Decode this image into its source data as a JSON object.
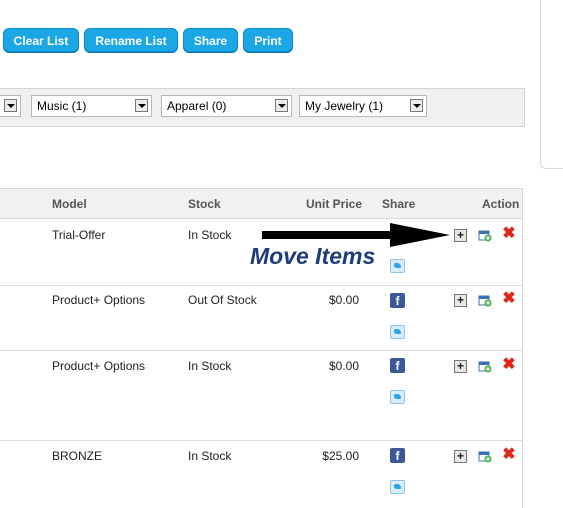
{
  "toolbar": {
    "clear_label": "Clear List",
    "rename_label": "Rename List",
    "share_label": "Share",
    "print_label": "Print"
  },
  "filters": {
    "items": [
      {
        "label": ""
      },
      {
        "label": "Music (1)"
      },
      {
        "label": "Apparel (0)"
      },
      {
        "label": "My Jewelry (1)"
      }
    ]
  },
  "table": {
    "headers": {
      "model": "Model",
      "stock": "Stock",
      "unit_price": "Unit Price",
      "share": "Share",
      "action": "Action"
    },
    "rows": [
      {
        "model": "Trial-Offer",
        "stock": "In Stock",
        "price": ""
      },
      {
        "model": "Product+ Options",
        "stock": "Out Of Stock",
        "price": "$0.00"
      },
      {
        "model": "Product+ Options",
        "stock": "In Stock",
        "price": "$0.00"
      },
      {
        "model": "BRONZE",
        "stock": "In Stock",
        "price": "$25.00"
      }
    ]
  },
  "annotation": {
    "text": "Move Items"
  },
  "icons": {
    "facebook": "facebook-icon",
    "twitter": "twitter-icon",
    "move": "move-icon",
    "calendar": "calendar-add-icon",
    "delete": "delete-icon"
  },
  "colors": {
    "button_bg": "#1ba6e6",
    "annotation": "#1e3c78",
    "delete": "#e1261c",
    "facebook": "#3b5998"
  }
}
